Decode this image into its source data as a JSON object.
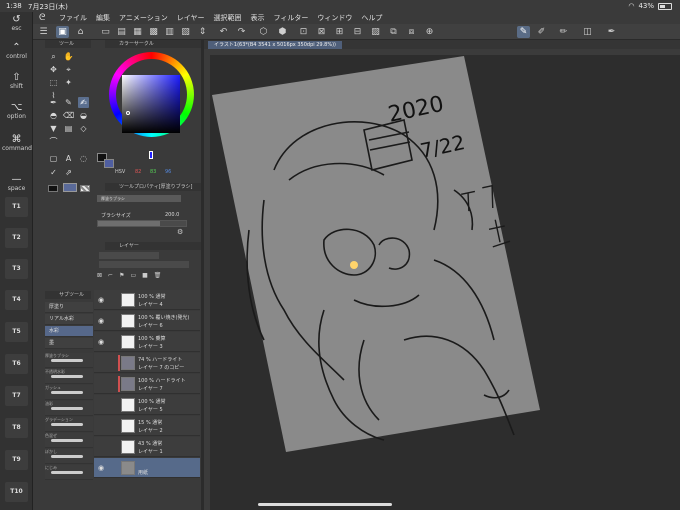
{
  "status_bar": {
    "time": "1:38",
    "date": "7月23日(木)",
    "battery": "43%",
    "battery_level": 0.43
  },
  "modifier_bar": {
    "keys": [
      {
        "label": "esc"
      },
      {
        "label": "control"
      },
      {
        "label": "shift"
      },
      {
        "label": "option"
      },
      {
        "label": "command"
      },
      {
        "label": "space"
      }
    ],
    "tkeys": [
      "T1",
      "T2",
      "T3",
      "T4",
      "T5",
      "T6",
      "T7",
      "T8",
      "T9",
      "T10"
    ]
  },
  "menu": [
    "ファイル",
    "編集",
    "アニメーション",
    "レイヤー",
    "選択範囲",
    "表示",
    "フィルター",
    "ウィンドウ",
    "ヘルプ"
  ],
  "panels": {
    "tool_title": "ツール",
    "color_circle_title": "カラーサークル",
    "color_values": {
      "r": "82",
      "g": "83",
      "b": "96"
    },
    "tool_property_title": "ツールプロパティ[厚塗りブラシ]",
    "tool_property_name": "厚塗りブラシ",
    "brush_size_label": "ブラシサイズ",
    "brush_size_value": "200.0",
    "subtool_title": "サブツール",
    "subtools": [
      {
        "label": "厚塗り",
        "selected": false
      },
      {
        "label": "リアル水彩",
        "selected": false
      },
      {
        "label": "水彩",
        "selected": true
      },
      {
        "label": "墨",
        "selected": false
      }
    ],
    "brush_presets": [
      {
        "label": "厚塗りブラシ"
      },
      {
        "label": "不透明水彩"
      },
      {
        "label": "ガッシュ"
      },
      {
        "label": "油彩"
      },
      {
        "label": "グラデーション"
      },
      {
        "label": "色混ぜ"
      },
      {
        "label": "ぼかし"
      },
      {
        "label": "にじみ"
      }
    ],
    "layer_title": "レイヤー",
    "layers": [
      {
        "mode": "100 % 通常",
        "name": "レイヤー 4",
        "visible": true,
        "red": false,
        "selected": false
      },
      {
        "mode": "100 % 覆い焼き(発光)",
        "name": "レイヤー 6",
        "visible": true,
        "red": false,
        "selected": false
      },
      {
        "mode": "100 % 乗算",
        "name": "レイヤー 3",
        "visible": true,
        "red": false,
        "selected": false
      },
      {
        "mode": "74 % ハードライト",
        "name": "レイヤー 7 のコピー",
        "visible": false,
        "red": true,
        "selected": false
      },
      {
        "mode": "100 % ハードライト",
        "name": "レイヤー 7",
        "visible": false,
        "red": true,
        "selected": false
      },
      {
        "mode": "100 % 通常",
        "name": "レイヤー 5",
        "visible": false,
        "red": false,
        "selected": false
      },
      {
        "mode": "15 % 通常",
        "name": "レイヤー 2",
        "visible": false,
        "red": false,
        "selected": false
      },
      {
        "mode": "43 % 通常",
        "name": "レイヤー 1",
        "visible": false,
        "red": false,
        "selected": false
      },
      {
        "mode": "",
        "name": "用紙",
        "visible": true,
        "red": false,
        "selected": true
      }
    ]
  },
  "document_tab": "イラスト1(63*(B4 3541 x 5016px 350dpi 29.8%))",
  "canvas_text": {
    "year": "2020",
    "date": "7/22"
  }
}
